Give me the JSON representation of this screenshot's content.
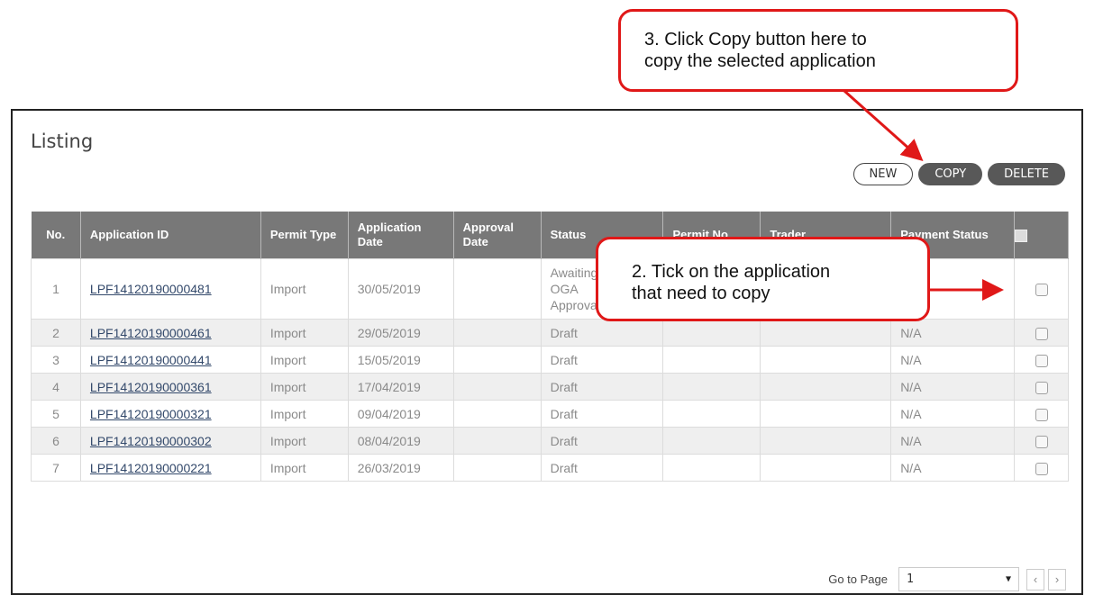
{
  "panel": {
    "title": "Listing",
    "actions": {
      "new": "NEW",
      "copy": "COPY",
      "delete": "DELETE"
    }
  },
  "table": {
    "headers": [
      "No.",
      "Application ID",
      "Permit Type",
      "Application Date",
      "Approval Date",
      "Status",
      "Permit No.",
      "Trader",
      "Payment Status"
    ],
    "rows": [
      {
        "no": "1",
        "app_id": "LPF14120190000481",
        "permit_type": "Import",
        "app_date": "30/05/2019",
        "approval_date": "",
        "status": "Awaiting OGA Approval",
        "permit_no": "",
        "trader": "",
        "payment": ""
      },
      {
        "no": "2",
        "app_id": "LPF14120190000461",
        "permit_type": "Import",
        "app_date": "29/05/2019",
        "approval_date": "",
        "status": "Draft",
        "permit_no": "",
        "trader": "",
        "payment": "N/A"
      },
      {
        "no": "3",
        "app_id": "LPF14120190000441",
        "permit_type": "Import",
        "app_date": "15/05/2019",
        "approval_date": "",
        "status": "Draft",
        "permit_no": "",
        "trader": "",
        "payment": "N/A"
      },
      {
        "no": "4",
        "app_id": "LPF14120190000361",
        "permit_type": "Import",
        "app_date": "17/04/2019",
        "approval_date": "",
        "status": "Draft",
        "permit_no": "",
        "trader": "",
        "payment": "N/A"
      },
      {
        "no": "5",
        "app_id": "LPF14120190000321",
        "permit_type": "Import",
        "app_date": "09/04/2019",
        "approval_date": "",
        "status": "Draft",
        "permit_no": "",
        "trader": "",
        "payment": "N/A"
      },
      {
        "no": "6",
        "app_id": "LPF14120190000302",
        "permit_type": "Import",
        "app_date": "08/04/2019",
        "approval_date": "",
        "status": "Draft",
        "permit_no": "",
        "trader": "",
        "payment": "N/A"
      },
      {
        "no": "7",
        "app_id": "LPF14120190000221",
        "permit_type": "Import",
        "app_date": "26/03/2019",
        "approval_date": "",
        "status": "Draft",
        "permit_no": "",
        "trader": "",
        "payment": "N/A"
      }
    ]
  },
  "pager": {
    "goto_label": "Go to Page",
    "page_value": "1",
    "prev": "‹",
    "next": "›"
  },
  "callouts": {
    "step3": [
      "3. Click Copy button here to",
      "copy the selected application"
    ],
    "step2": [
      "2. Tick on the application",
      "that need to copy"
    ]
  },
  "colors": {
    "header_bg": "#787878",
    "dark_button": "#585858",
    "callout_border": "#e01818",
    "link": "#33496b"
  }
}
